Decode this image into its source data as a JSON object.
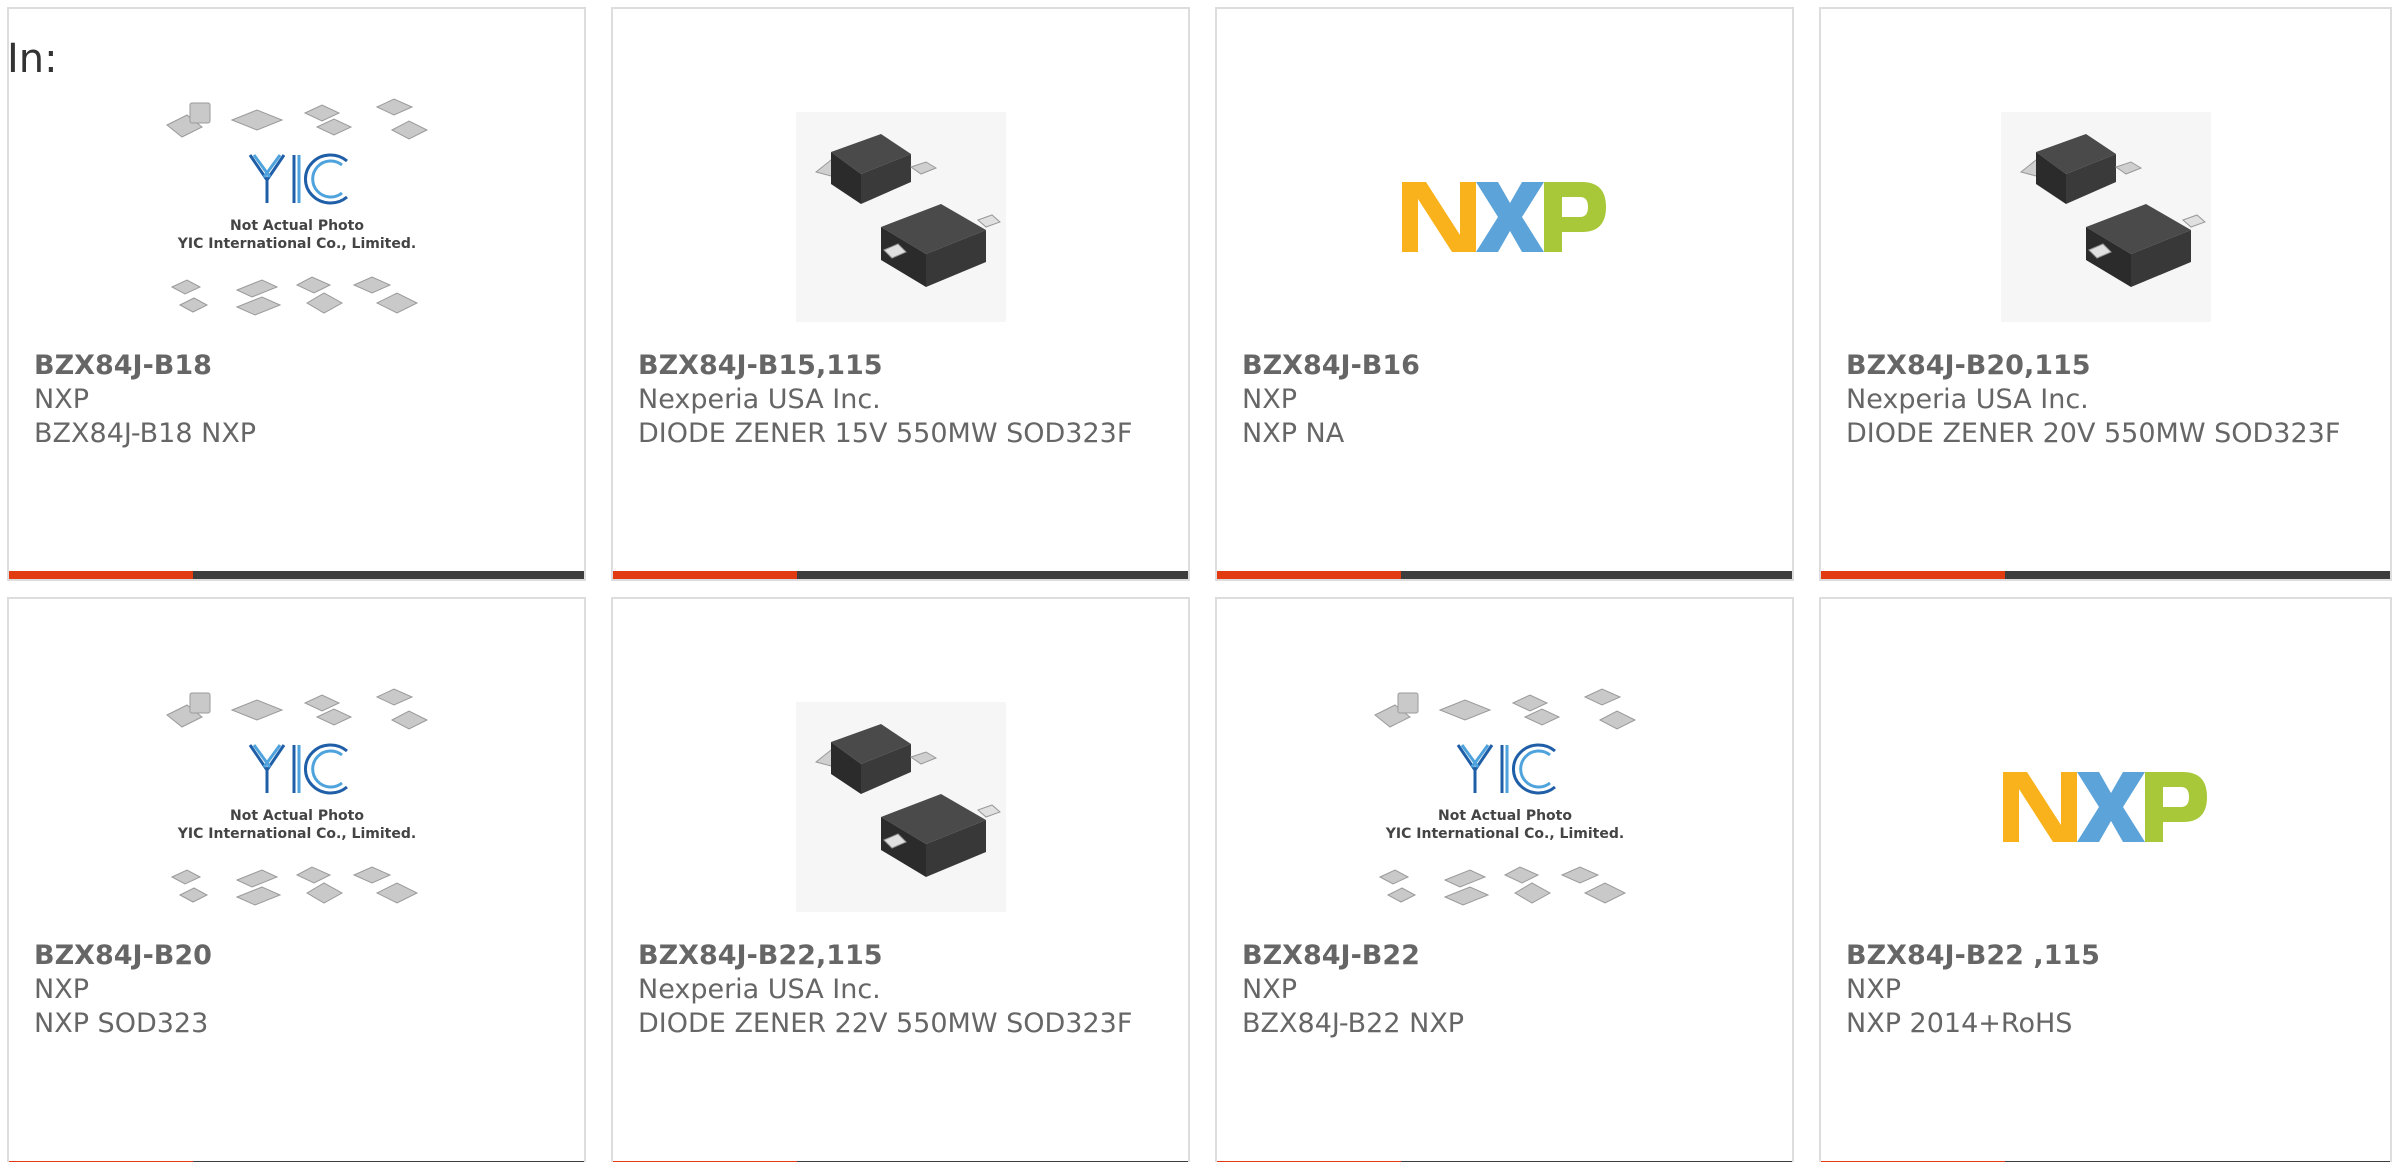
{
  "heading": "In:",
  "colors": {
    "accent": "#e23b12",
    "bar": "#3d3d3d",
    "text": "#666666",
    "border": "#dddddd",
    "nxp_orange": "#f9b21b",
    "nxp_blue": "#5ba3d9",
    "nxp_green": "#a8c83a"
  },
  "products": [
    {
      "part": "BZX84J-B18",
      "maker": "NXP",
      "desc": "BZX84J-B18 NXP",
      "image": "yic-placeholder",
      "image_caption_1": "Not Actual Photo",
      "image_caption_2": "YIC International Co., Limited."
    },
    {
      "part": "BZX84J-B15,115",
      "maker": "Nexperia USA Inc.",
      "desc": "DIODE ZENER 15V 550MW SOD323F",
      "image": "sod323-diode-photo"
    },
    {
      "part": "BZX84J-B16",
      "maker": "NXP",
      "desc": "NXP NA",
      "image": "nxp-logo"
    },
    {
      "part": "BZX84J-B20,115",
      "maker": "Nexperia USA Inc.",
      "desc": "DIODE ZENER 20V 550MW SOD323F",
      "image": "sod323-diode-photo"
    },
    {
      "part": "BZX84J-B20",
      "maker": "NXP",
      "desc": "NXP SOD323",
      "image": "yic-placeholder",
      "image_caption_1": "Not Actual Photo",
      "image_caption_2": "YIC International Co., Limited."
    },
    {
      "part": "BZX84J-B22,115",
      "maker": "Nexperia USA Inc.",
      "desc": "DIODE ZENER 22V 550MW SOD323F",
      "image": "sod323-diode-photo"
    },
    {
      "part": "BZX84J-B22",
      "maker": "NXP",
      "desc": "BZX84J-B22 NXP",
      "image": "yic-placeholder",
      "image_caption_1": "Not Actual Photo",
      "image_caption_2": "YIC International Co., Limited."
    },
    {
      "part": "BZX84J-B22 ,115",
      "maker": "NXP",
      "desc": "NXP 2014+RoHS",
      "image": "nxp-logo"
    }
  ]
}
